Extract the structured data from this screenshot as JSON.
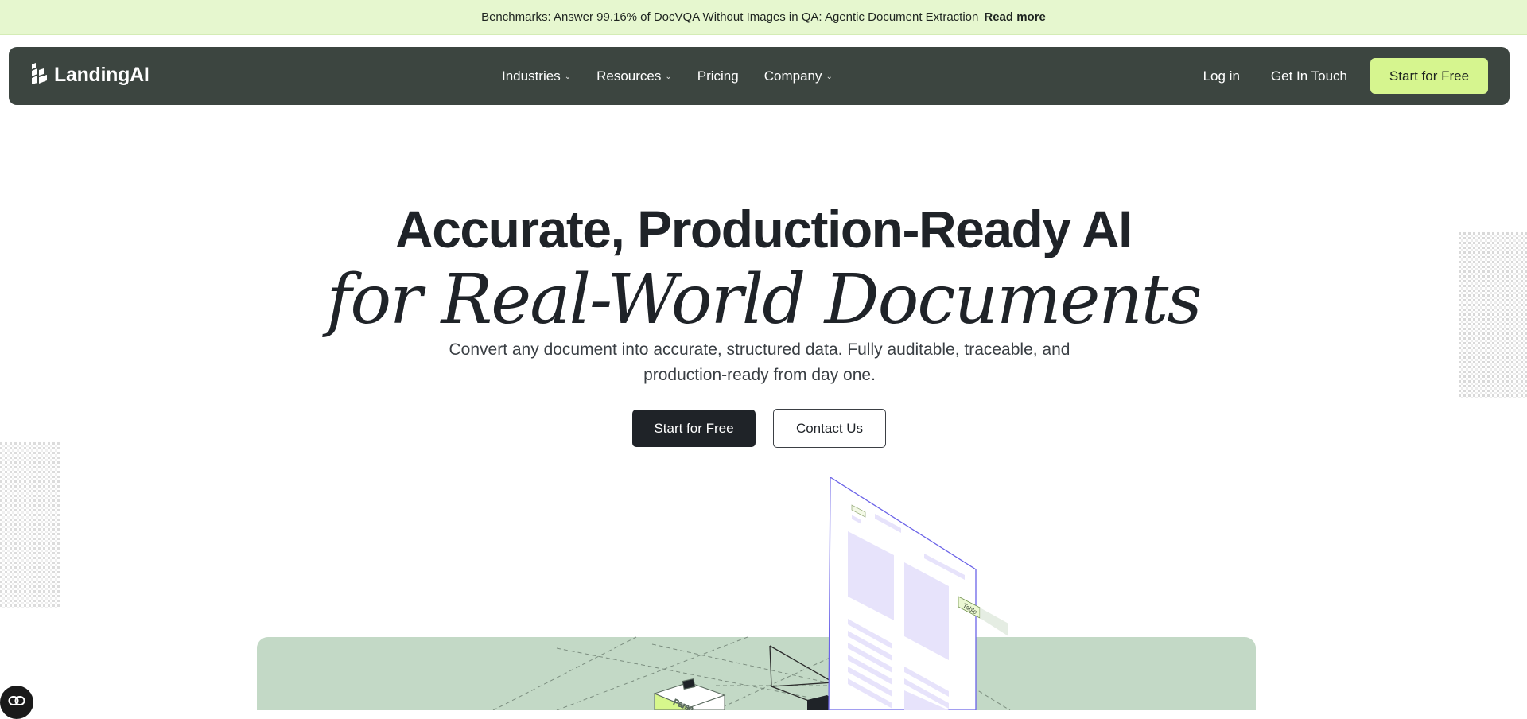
{
  "banner": {
    "text": "Benchmarks: Answer 99.16% of DocVQA Without Images in QA: Agentic Document Extraction",
    "link": "Read more"
  },
  "nav": {
    "brand": "LandingAI",
    "menu": [
      {
        "label": "Industries",
        "has_dropdown": true
      },
      {
        "label": "Resources",
        "has_dropdown": true
      },
      {
        "label": "Pricing",
        "has_dropdown": false
      },
      {
        "label": "Company",
        "has_dropdown": true
      }
    ],
    "login": "Log in",
    "get_in_touch": "Get In Touch",
    "cta": "Start for Free"
  },
  "hero": {
    "title_line1": "Accurate, Production-Ready AI",
    "title_line2": "for Real-World Documents",
    "subtitle": "Convert any document into accurate, structured data. Fully auditable, traceable, and production-ready from day one.",
    "primary_button": "Start for Free",
    "secondary_button": "Contact Us"
  },
  "illustration": {
    "doc_tag": "Table",
    "cube_label": "Parse"
  },
  "colors": {
    "banner_bg": "#e6f7cf",
    "nav_bg": "#3c4540",
    "accent": "#d6f58f",
    "stage_bg": "#c3d9c6",
    "doc_outline": "#6b63e8",
    "doc_fill": "#e7e3fb"
  }
}
